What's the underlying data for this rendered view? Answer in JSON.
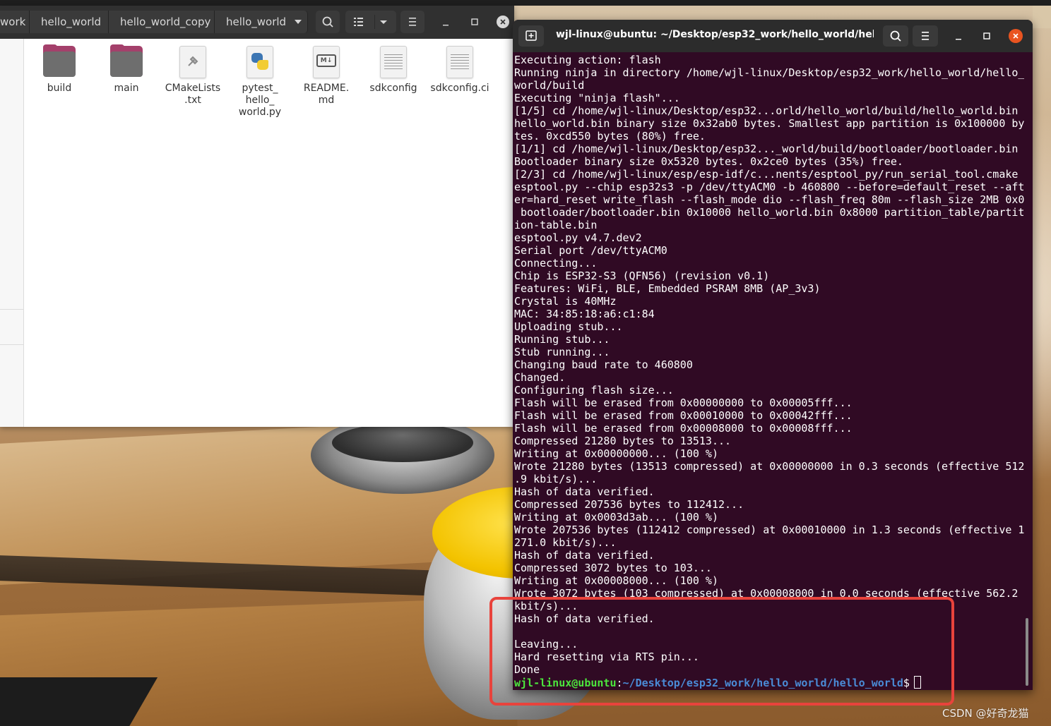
{
  "file_manager": {
    "breadcrumbs": [
      "work",
      "hello_world",
      "hello_world_copy",
      "hello_world"
    ],
    "items": [
      {
        "label": "build",
        "icon": "folder-icon"
      },
      {
        "label": "main",
        "icon": "folder-icon"
      },
      {
        "label": "CMakeLists\n.txt",
        "icon": "cmake-file-icon"
      },
      {
        "label": "pytest_\nhello_\nworld.py",
        "icon": "python-file-icon"
      },
      {
        "label": "README.\nmd",
        "icon": "markdown-file-icon"
      },
      {
        "label": "sdkconfig",
        "icon": "text-file-icon"
      },
      {
        "label": "sdkconfig.ci",
        "icon": "text-file-icon"
      }
    ]
  },
  "terminal": {
    "title": "wjl-linux@ubuntu: ~/Desktop/esp32_work/hello_world/hello...",
    "lines": [
      "Executing action: flash",
      "Running ninja in directory /home/wjl-linux/Desktop/esp32_work/hello_world/hello_",
      "world/build",
      "Executing \"ninja flash\"...",
      "[1/5] cd /home/wjl-linux/Desktop/esp32...orld/hello_world/build/hello_world.bin",
      "hello_world.bin binary size 0x32ab0 bytes. Smallest app partition is 0x100000 by",
      "tes. 0xcd550 bytes (80%) free.",
      "[1/1] cd /home/wjl-linux/Desktop/esp32..._world/build/bootloader/bootloader.bin",
      "Bootloader binary size 0x5320 bytes. 0x2ce0 bytes (35%) free.",
      "[2/3] cd /home/wjl-linux/esp/esp-idf/c...nents/esptool_py/run_serial_tool.cmake",
      "esptool.py --chip esp32s3 -p /dev/ttyACM0 -b 460800 --before=default_reset --aft",
      "er=hard_reset write_flash --flash_mode dio --flash_freq 80m --flash_size 2MB 0x0",
      " bootloader/bootloader.bin 0x10000 hello_world.bin 0x8000 partition_table/partit",
      "ion-table.bin",
      "esptool.py v4.7.dev2",
      "Serial port /dev/ttyACM0",
      "Connecting...",
      "Chip is ESP32-S3 (QFN56) (revision v0.1)",
      "Features: WiFi, BLE, Embedded PSRAM 8MB (AP_3v3)",
      "Crystal is 40MHz",
      "MAC: 34:85:18:a6:c1:84",
      "Uploading stub...",
      "Running stub...",
      "Stub running...",
      "Changing baud rate to 460800",
      "Changed.",
      "Configuring flash size...",
      "Flash will be erased from 0x00000000 to 0x00005fff...",
      "Flash will be erased from 0x00010000 to 0x00042fff...",
      "Flash will be erased from 0x00008000 to 0x00008fff...",
      "Compressed 21280 bytes to 13513...",
      "Writing at 0x00000000... (100 %)",
      "Wrote 21280 bytes (13513 compressed) at 0x00000000 in 0.3 seconds (effective 512",
      ".9 kbit/s)...",
      "Hash of data verified.",
      "Compressed 207536 bytes to 112412...",
      "Writing at 0x0003d3ab... (100 %)",
      "Wrote 207536 bytes (112412 compressed) at 0x00010000 in 1.3 seconds (effective 1",
      "271.0 kbit/s)...",
      "Hash of data verified.",
      "Compressed 3072 bytes to 103...",
      "Writing at 0x00008000... (100 %)",
      "Wrote 3072 bytes (103 compressed) at 0x00008000 in 0.0 seconds (effective 562.2",
      "kbit/s)...",
      "Hash of data verified.",
      "",
      "Leaving...",
      "Hard resetting via RTS pin...",
      "Done"
    ],
    "prompt": {
      "user_host": "wjl-linux@ubuntu",
      "colon": ":",
      "path": "~/Desktop/esp32_work/hello_world/hello_world",
      "symbol": "$"
    }
  },
  "watermark": "CSDN @好奇龙猫",
  "colors": {
    "terminal_bg": "#300a24",
    "prompt_user": "#4ce63d",
    "prompt_path": "#4a8bd6",
    "highlight": "#e8433c",
    "close_button": "#e95420"
  }
}
